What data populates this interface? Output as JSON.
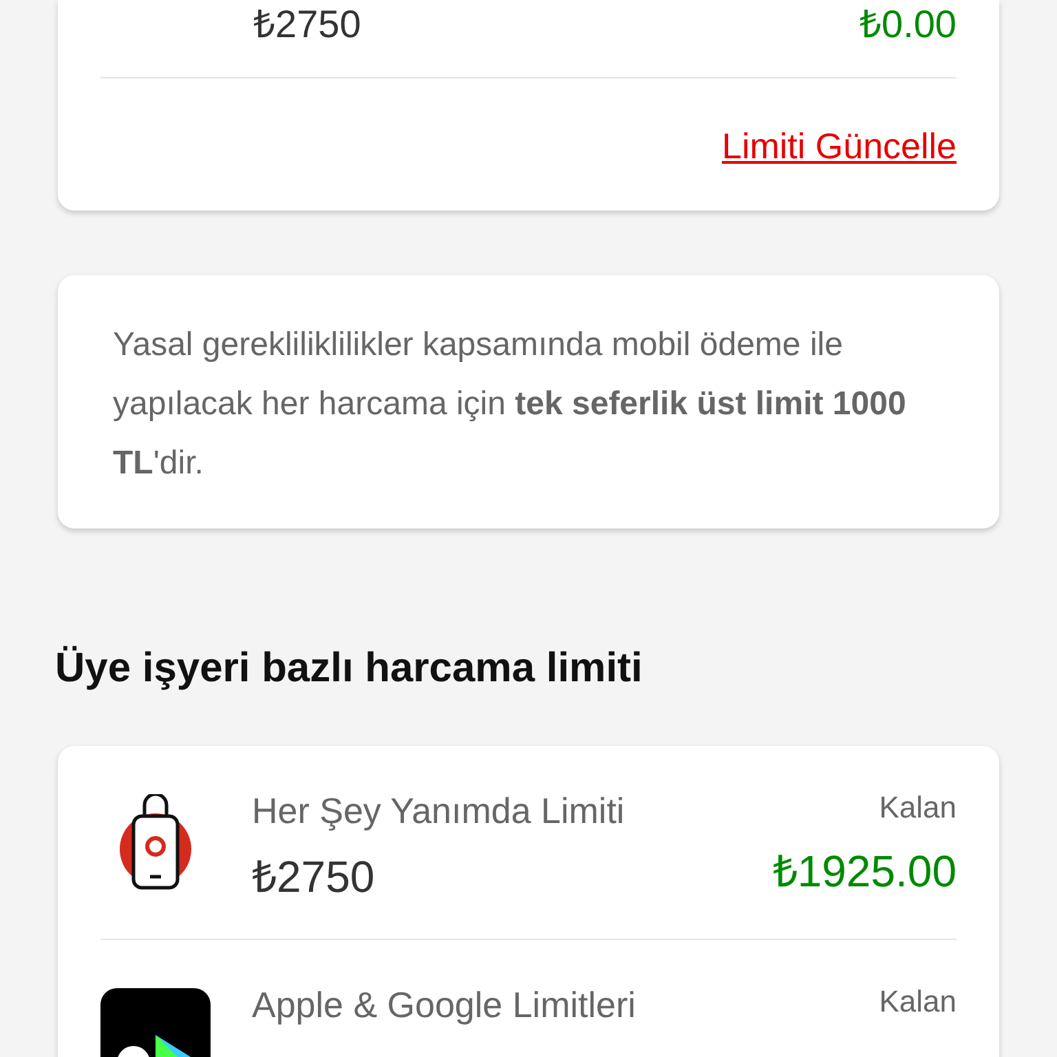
{
  "top_card": {
    "amount": "₺2750",
    "remaining": "₺0.00",
    "link": "Limiti Güncelle"
  },
  "info_text": "Yasal gerekliliklilikler kapsamında mobil ödeme ile yapılacak her harcama için **tek seferlik üst limit 1000 TL**'dir.",
  "section_title": "Üye işyeri bazlı harcama limiti",
  "merchant_limits": [
    {
      "kind": "bag",
      "title": "Her Şey Yanımda Limiti",
      "amount": "₺2750",
      "remaining_label": "Kalan",
      "remaining": "₺1925.00"
    },
    {
      "kind": "stores",
      "title": "Apple & Google Limitleri",
      "remaining_label": "Kalan"
    }
  ]
}
